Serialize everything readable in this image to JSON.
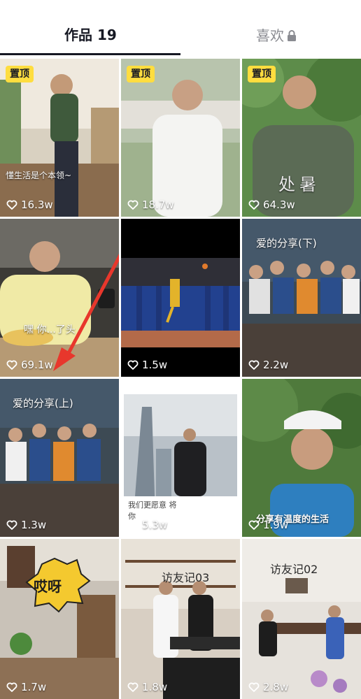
{
  "tabs": {
    "works_label": "作品 19",
    "likes_label": "喜欢"
  },
  "pin_label": "置顶",
  "videos": [
    {
      "likes": "16.3w",
      "pinned": true,
      "caption": "懂生活是个本领~"
    },
    {
      "likes": "18.7w",
      "pinned": true
    },
    {
      "likes": "64.3w",
      "pinned": true,
      "caption": "处暑"
    },
    {
      "likes": "69.1w",
      "caption": "嘿 你...了头"
    },
    {
      "likes": "1.5w"
    },
    {
      "likes": "2.2w",
      "caption": "爱的分享(下)"
    },
    {
      "likes": "1.3w",
      "caption": "爱的分享(上)"
    },
    {
      "likes": "5.3w",
      "caption": "我们更愿意 将你"
    },
    {
      "likes": "1.9w",
      "caption": "分享有温度的生活"
    },
    {
      "likes": "1.7w",
      "caption": "哎呀"
    },
    {
      "likes": "1.8w",
      "caption": "访友记03"
    },
    {
      "likes": "2.8w",
      "caption": "访友记02"
    }
  ],
  "colors": {
    "accent_yellow": "#fedd3f",
    "arrow_red": "#e8372c"
  }
}
